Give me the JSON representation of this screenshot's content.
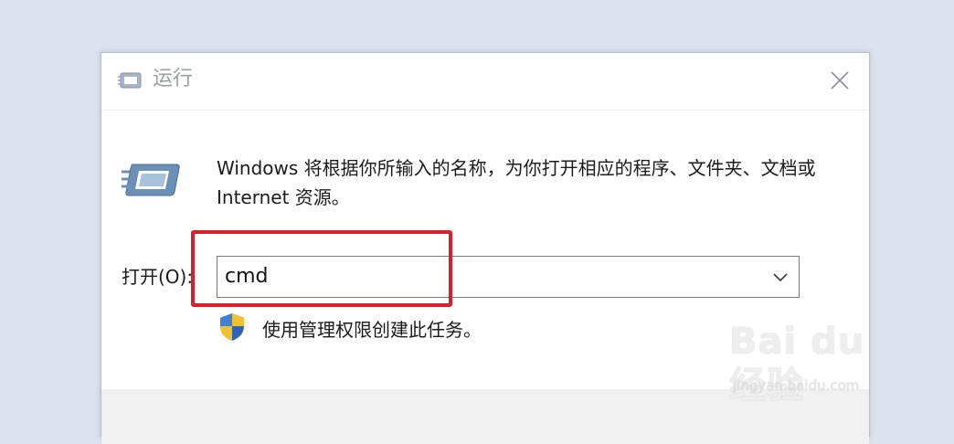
{
  "window": {
    "title": "运行",
    "close_icon": "close-icon",
    "app_icon": "run-app-icon"
  },
  "body": {
    "description": "Windows 将根据你所输入的名称，为你打开相应的程序、文件夹、文档或 Internet 资源。",
    "open_label": "打开(O):",
    "open_value": "cmd",
    "admin_note": "使用管理权限创建此任务。",
    "shield_icon": "uac-shield-icon",
    "dropdown_icon": "chevron-down-icon"
  },
  "annotation": {
    "highlight_color": "#d9202a"
  },
  "watermark": {
    "logo": "Bai du 经验",
    "url": "jingyan.baidu.com"
  }
}
